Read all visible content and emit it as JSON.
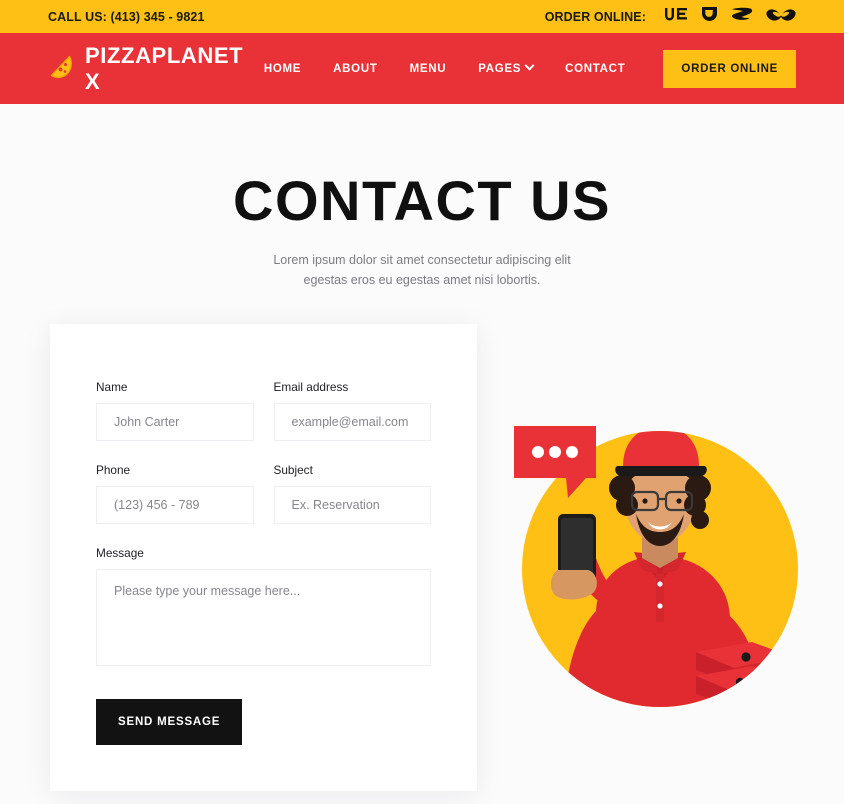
{
  "topbar": {
    "phone_label": "CALL US: (413) 345 - 9821",
    "order_online_label": "ORDER ONLINE:",
    "services": [
      {
        "name": "ubereats-icon",
        "label": "UE"
      },
      {
        "name": "doordash-icon",
        "label": "DoorDash"
      },
      {
        "name": "grubhub-icon",
        "label": "Grubhub"
      },
      {
        "name": "postmates-icon",
        "label": "Postmates"
      }
    ],
    "bg_color": "#FFC015",
    "text_color": "#1a1a1a"
  },
  "navbar": {
    "brand": "PIZZAPLANET X",
    "logo_icon": "pizza-slice-icon",
    "bg_color": "#E93237",
    "links": [
      {
        "label": "HOME",
        "has_chevron": false
      },
      {
        "label": "ABOUT",
        "has_chevron": false
      },
      {
        "label": "MENU",
        "has_chevron": false
      },
      {
        "label": "PAGES",
        "has_chevron": true
      },
      {
        "label": "CONTACT",
        "has_chevron": false
      }
    ],
    "cta_label": "ORDER ONLINE",
    "cta_bg": "#FFC015"
  },
  "page": {
    "title": "CONTACT US",
    "subtitle": "Lorem ipsum dolor sit amet consectetur adipiscing elit egestas eros eu egestas amet nisi lobortis.",
    "bg_color": "#fbfbfc"
  },
  "form": {
    "fields": [
      {
        "label": "Name",
        "placeholder": "John Carter",
        "value": "",
        "name": "name-field"
      },
      {
        "label": "Email address",
        "placeholder": "example@email.com",
        "value": "",
        "name": "email-field"
      },
      {
        "label": "Phone",
        "placeholder": "(123) 456 - 789",
        "value": "",
        "name": "phone-field"
      },
      {
        "label": "Subject",
        "placeholder": "Ex. Reservation",
        "value": "",
        "name": "subject-field"
      }
    ],
    "message": {
      "label": "Message",
      "placeholder": "Please type your message here...",
      "value": ""
    },
    "submit_label": "SEND MESSAGE",
    "submit_bg": "#121212",
    "card_bg": "#ffffff"
  },
  "illustration": {
    "alt": "Pizza delivery man holding a smartphone with pizza boxes",
    "circle_color": "#FFC015",
    "bubble_color": "#E93237",
    "bubble_dots": 3,
    "uniform_color": "#E12A2F"
  }
}
